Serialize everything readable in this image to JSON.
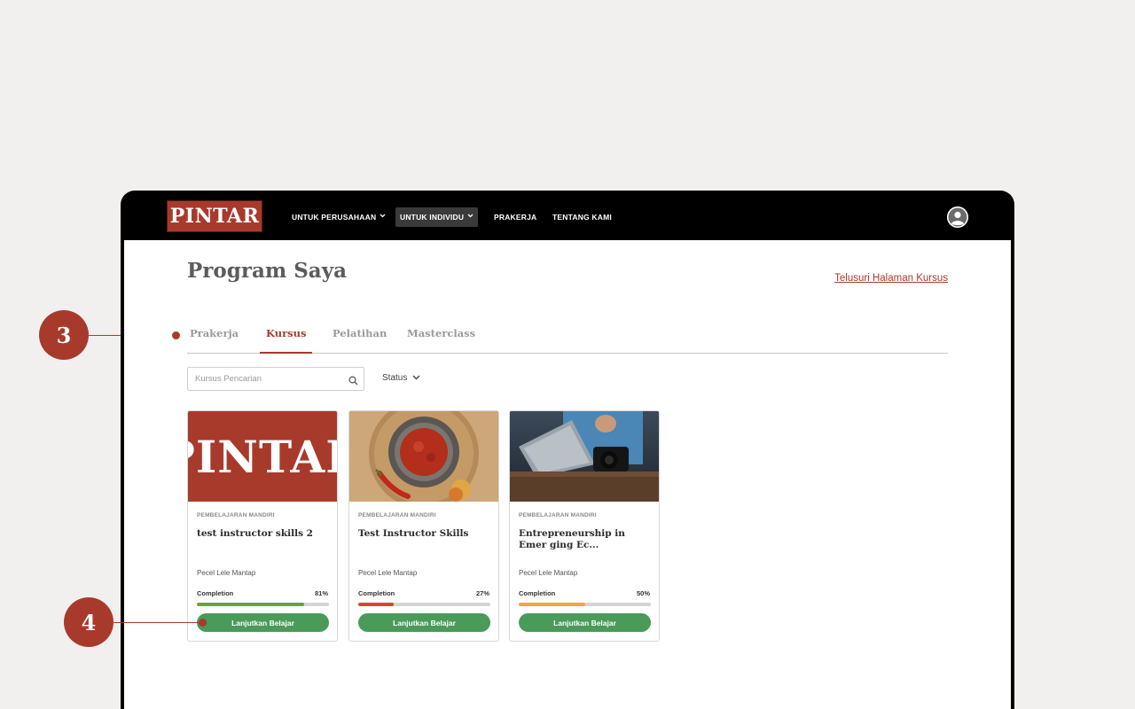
{
  "nav": {
    "logo": "PINTAR",
    "items": [
      {
        "label": "UNTUK PERUSAHAAN",
        "has_dropdown": true,
        "active": false
      },
      {
        "label": "UNTUK INDIVIDU",
        "has_dropdown": true,
        "active": true
      },
      {
        "label": "PRAKERJA",
        "has_dropdown": false,
        "active": false
      },
      {
        "label": "TENTANG KAMI",
        "has_dropdown": false,
        "active": false
      }
    ],
    "avatar_icon": "user-avatar-icon"
  },
  "page": {
    "title": "Program Saya",
    "browse_link": "Telusuri Halaman Kursus"
  },
  "tabs": [
    {
      "label": "Prakerja",
      "active": false
    },
    {
      "label": "Kursus",
      "active": true
    },
    {
      "label": "Pelatihan",
      "active": false
    },
    {
      "label": "Masterclass",
      "active": false
    }
  ],
  "filters": {
    "search_placeholder": "Kursus Pencarian",
    "search_value": "",
    "status_label": "Status"
  },
  "courses": [
    {
      "thumbnail": "pintar-logo-image",
      "thumbnail_text": "PINTAR",
      "type": "PEMBELAJARAN MANDIRI",
      "title": "test instructor skills 2",
      "author": "Pecel Lele Mantap",
      "completion_label": "Completion",
      "completion_text": "81%",
      "completion": 0.81,
      "progress_color": "#6aa23e",
      "button": "Lanjutkan Belajar"
    },
    {
      "thumbnail": "sambal-bowl-image",
      "type": "PEMBELAJARAN MANDIRI",
      "title": "Test Instructor Skills",
      "author": "Pecel Lele Mantap",
      "completion_label": "Completion",
      "completion_text": "27%",
      "completion": 0.27,
      "progress_color": "#d9462f",
      "button": "Lanjutkan Belajar"
    },
    {
      "thumbnail": "laptop-camera-image",
      "type": "PEMBELAJARAN MANDIRI",
      "title": "Entrepreneurship in Emer ging Ec...",
      "author": "Pecel Lele Mantap",
      "completion_label": "Completion",
      "completion_text": "50%",
      "completion": 0.5,
      "progress_color": "#f0a83c",
      "button": "Lanjutkan Belajar"
    }
  ],
  "callouts": [
    {
      "number": "3"
    },
    {
      "number": "4"
    }
  ],
  "colors": {
    "brand": "#a83a2c",
    "button_green": "#4a9a5a",
    "nav_bg": "#000000"
  }
}
